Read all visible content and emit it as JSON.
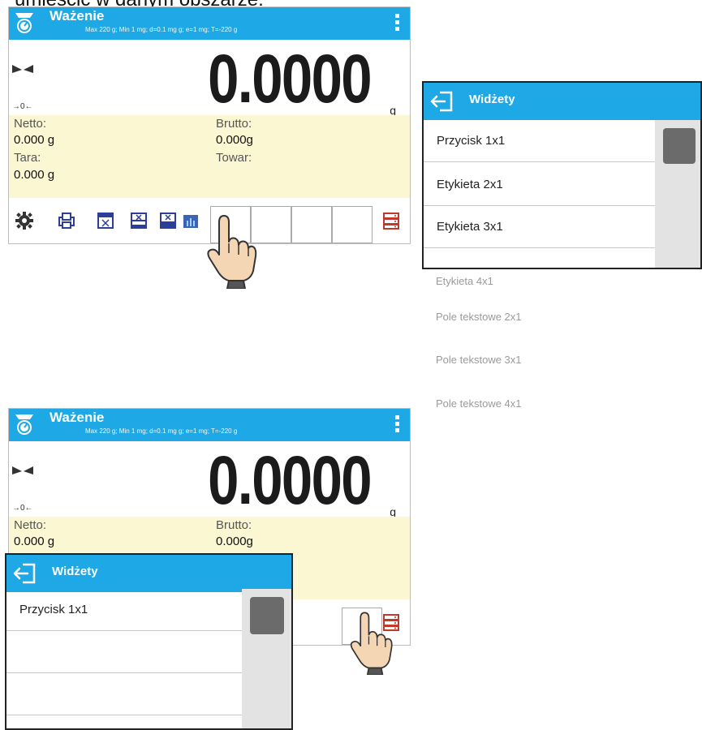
{
  "caption": "umieścić w danym obszarze:",
  "screen": {
    "title": "Ważenie",
    "subtitle": "Max 220 g; Min 1 mg; d=0.1 mg g; e=1 mg; T=-220 g",
    "subtitle_bottom": "Max 220 g; Min 1 mg; d=0.1 mg g; e=1 mg; T=-220 g",
    "zero_indicator": "→0←",
    "reading": "0.0000",
    "unit": "g",
    "netto_label": "Netto:",
    "netto_value": "0.000 g",
    "brutto_label": "Brutto:",
    "brutto_value": "0.000g",
    "tara_label": "Tara:",
    "tara_value": "0.000 g",
    "towar_label": "Towar:"
  },
  "widgets_panel": {
    "title": "Widżety",
    "items": [
      "Przycisk 1x1",
      "Etykieta 2x1",
      "Etykieta 3x1"
    ],
    "hidden_items": [
      "Etykieta 4x1",
      "Pole tekstowe 2x1",
      "Pole tekstowe 3x1",
      "Pole tekstowe 4x1"
    ]
  },
  "widgets_panel_bottom": {
    "title": "Widżety",
    "items": [
      "Przycisk 1x1",
      "",
      "",
      ""
    ]
  },
  "icons": {
    "header_logo": "scale-icon",
    "menu": "kebab-menu-icon",
    "stability": "stability-icon",
    "settings": "gear-icon",
    "print": "print-icon",
    "database": "database-icon",
    "back": "exit-arrow-icon",
    "pointer": "hand-pointer-icon"
  },
  "colors": {
    "header_blue": "#1fa8e6",
    "info_yellow": "#fbf7d2",
    "database_red": "#c0392b"
  }
}
